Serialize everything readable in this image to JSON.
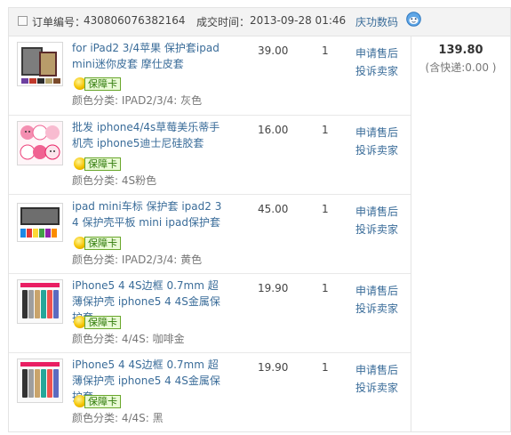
{
  "order": {
    "id_label": "订单编号：",
    "id": "430806076382164",
    "time_label": "成交时间：",
    "time": "2013-09-28 01:46",
    "shop": "庆功数码",
    "total": "139.80",
    "shipping": "(含快递:0.00 )"
  },
  "actions": {
    "after_sale": "申请售后",
    "complain": "投诉卖家"
  },
  "items": [
    {
      "title": "for iPad2 3/4苹果 保护套ipad mini迷你皮套 摩仕皮套",
      "badge": "保障卡",
      "attr": "颜色分类: IPAD2/3/4: 灰色",
      "price": "39.00",
      "qty": "1"
    },
    {
      "title": "批发 iphone4/4s草莓美乐蒂手机壳 iphone5迪士尼硅胶套",
      "badge": "保障卡",
      "attr": "颜色分类: 4S粉色",
      "price": "16.00",
      "qty": "1"
    },
    {
      "title": "ipad mini车标 保护套 ipad2 3 4 保护壳平板 mini ipad保护套",
      "badge": "保障卡",
      "attr": "颜色分类: IPAD2/3/4: 黄色",
      "price": "45.00",
      "qty": "1"
    },
    {
      "title": "iPhone5 4 4S边框 0.7mm 超薄保护壳 iphone5 4 4S金属保护套",
      "badge": "保障卡",
      "attr": "颜色分类: 4/4S: 咖啡金",
      "price": "19.90",
      "qty": "1"
    },
    {
      "title": "iPhone5 4 4S边框 0.7mm 超薄保护壳 iphone5 4 4S金属保护套",
      "badge": "保障卡",
      "attr": "颜色分类: 4/4S: 黑",
      "price": "19.90",
      "qty": "1"
    }
  ]
}
